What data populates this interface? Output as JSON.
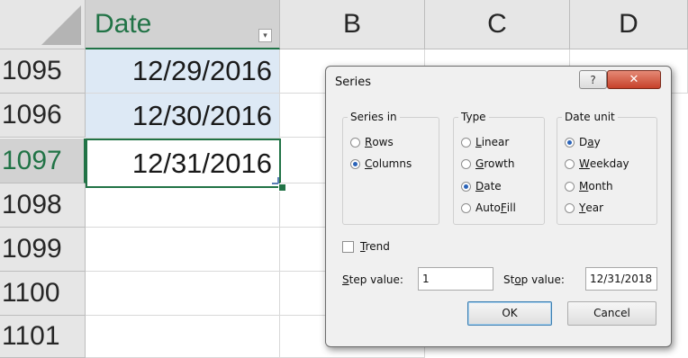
{
  "sheet": {
    "columns": [
      "Date",
      "B",
      "C",
      "D"
    ],
    "filter_glyph": "▾",
    "rows": [
      {
        "num": "1095",
        "value": "12/29/2016"
      },
      {
        "num": "1096",
        "value": "12/30/2016"
      },
      {
        "num": "1097",
        "value": "12/31/2016"
      },
      {
        "num": "1098",
        "value": ""
      },
      {
        "num": "1099",
        "value": ""
      },
      {
        "num": "1100",
        "value": ""
      },
      {
        "num": "1101",
        "value": ""
      }
    ]
  },
  "dialog": {
    "title": "Series",
    "help_glyph": "?",
    "close_glyph": "✕",
    "series_in": {
      "label": "Series in",
      "options": [
        {
          "pre": "",
          "key": "R",
          "post": "ows",
          "selected": false
        },
        {
          "pre": "",
          "key": "C",
          "post": "olumns",
          "selected": true
        }
      ]
    },
    "type": {
      "label": "Type",
      "options": [
        {
          "pre": "",
          "key": "L",
          "post": "inear",
          "selected": false
        },
        {
          "pre": "",
          "key": "G",
          "post": "rowth",
          "selected": false
        },
        {
          "pre": "",
          "key": "D",
          "post": "ate",
          "selected": true
        },
        {
          "pre": "Auto",
          "key": "F",
          "post": "ill",
          "selected": false
        }
      ]
    },
    "date_unit": {
      "label": "Date unit",
      "options": [
        {
          "pre": "D",
          "key": "a",
          "post": "y",
          "selected": true
        },
        {
          "pre": "",
          "key": "W",
          "post": "eekday",
          "selected": false
        },
        {
          "pre": "",
          "key": "M",
          "post": "onth",
          "selected": false
        },
        {
          "pre": "",
          "key": "Y",
          "post": "ear",
          "selected": false
        }
      ]
    },
    "trend": {
      "pre": "",
      "key": "T",
      "post": "rend",
      "checked": false
    },
    "step": {
      "pre": "",
      "key": "S",
      "post": "tep value:",
      "value": "1"
    },
    "stop": {
      "pre": "St",
      "key": "o",
      "post": "p value:",
      "value": "12/31/2018"
    },
    "ok_label": "OK",
    "cancel_label": "Cancel"
  }
}
